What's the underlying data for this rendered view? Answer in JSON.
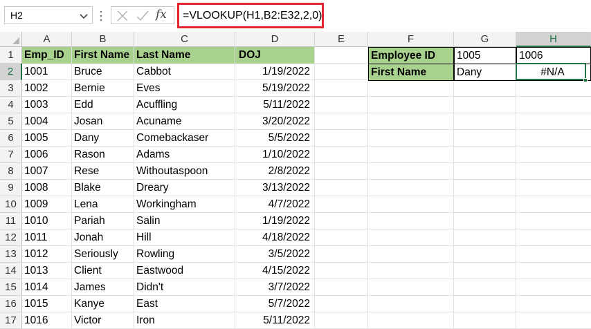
{
  "name_box": {
    "value": "H2"
  },
  "formula_bar": {
    "formula": "=VLOOKUP(H1,B2:E32,2,0)",
    "fx_label": "fx"
  },
  "columns": [
    "A",
    "B",
    "C",
    "D",
    "E",
    "F",
    "G",
    "H"
  ],
  "selected_column": "H",
  "rows": [
    "1",
    "2",
    "3",
    "4",
    "5",
    "6",
    "7",
    "8",
    "9",
    "10",
    "11",
    "12",
    "13",
    "14",
    "15",
    "16",
    "17"
  ],
  "selected_row": "2",
  "table": {
    "headers": [
      "Emp_ID",
      "First Name",
      "Last Name",
      "DOJ"
    ],
    "records": [
      [
        "1001",
        "Bruce",
        "Cabbot",
        "1/19/2022"
      ],
      [
        "1002",
        "Bernie",
        "Eves",
        "5/19/2022"
      ],
      [
        "1003",
        "Edd",
        "Acuffling",
        "5/11/2022"
      ],
      [
        "1004",
        "Josan",
        "Acuname",
        "3/20/2022"
      ],
      [
        "1005",
        "Dany",
        "Comebackaser",
        "5/5/2022"
      ],
      [
        "1006",
        "Rason",
        "Adams",
        "1/10/2022"
      ],
      [
        "1007",
        "Rese",
        "Withoutaspoon",
        "2/8/2022"
      ],
      [
        "1008",
        "Blake",
        "Dreary",
        "3/13/2022"
      ],
      [
        "1009",
        "Lena",
        "Workingham",
        "4/7/2022"
      ],
      [
        "1010",
        "Pariah",
        "Salin",
        "1/19/2022"
      ],
      [
        "1011",
        "Jonah",
        "Hill",
        "4/18/2022"
      ],
      [
        "1012",
        "Seriously",
        "Rowling",
        "3/5/2022"
      ],
      [
        "1013",
        "Client",
        "Eastwood",
        "4/15/2022"
      ],
      [
        "1014",
        "James",
        "Didn't",
        "3/7/2022"
      ],
      [
        "1015",
        "Kanye",
        "East",
        "5/7/2022"
      ],
      [
        "1016",
        "Victor",
        "Iron",
        "5/11/2022"
      ]
    ]
  },
  "lookup": {
    "employee_id_label": "Employee ID",
    "employee_id_g": "1005",
    "employee_id_h": "1006",
    "first_name_label": "First Name",
    "first_name_g": "Dany",
    "first_name_h": "#N/A"
  },
  "colors": {
    "header_fill": "#a9d18e",
    "excel_green": "#217346",
    "formula_highlight": "#e2252f"
  }
}
